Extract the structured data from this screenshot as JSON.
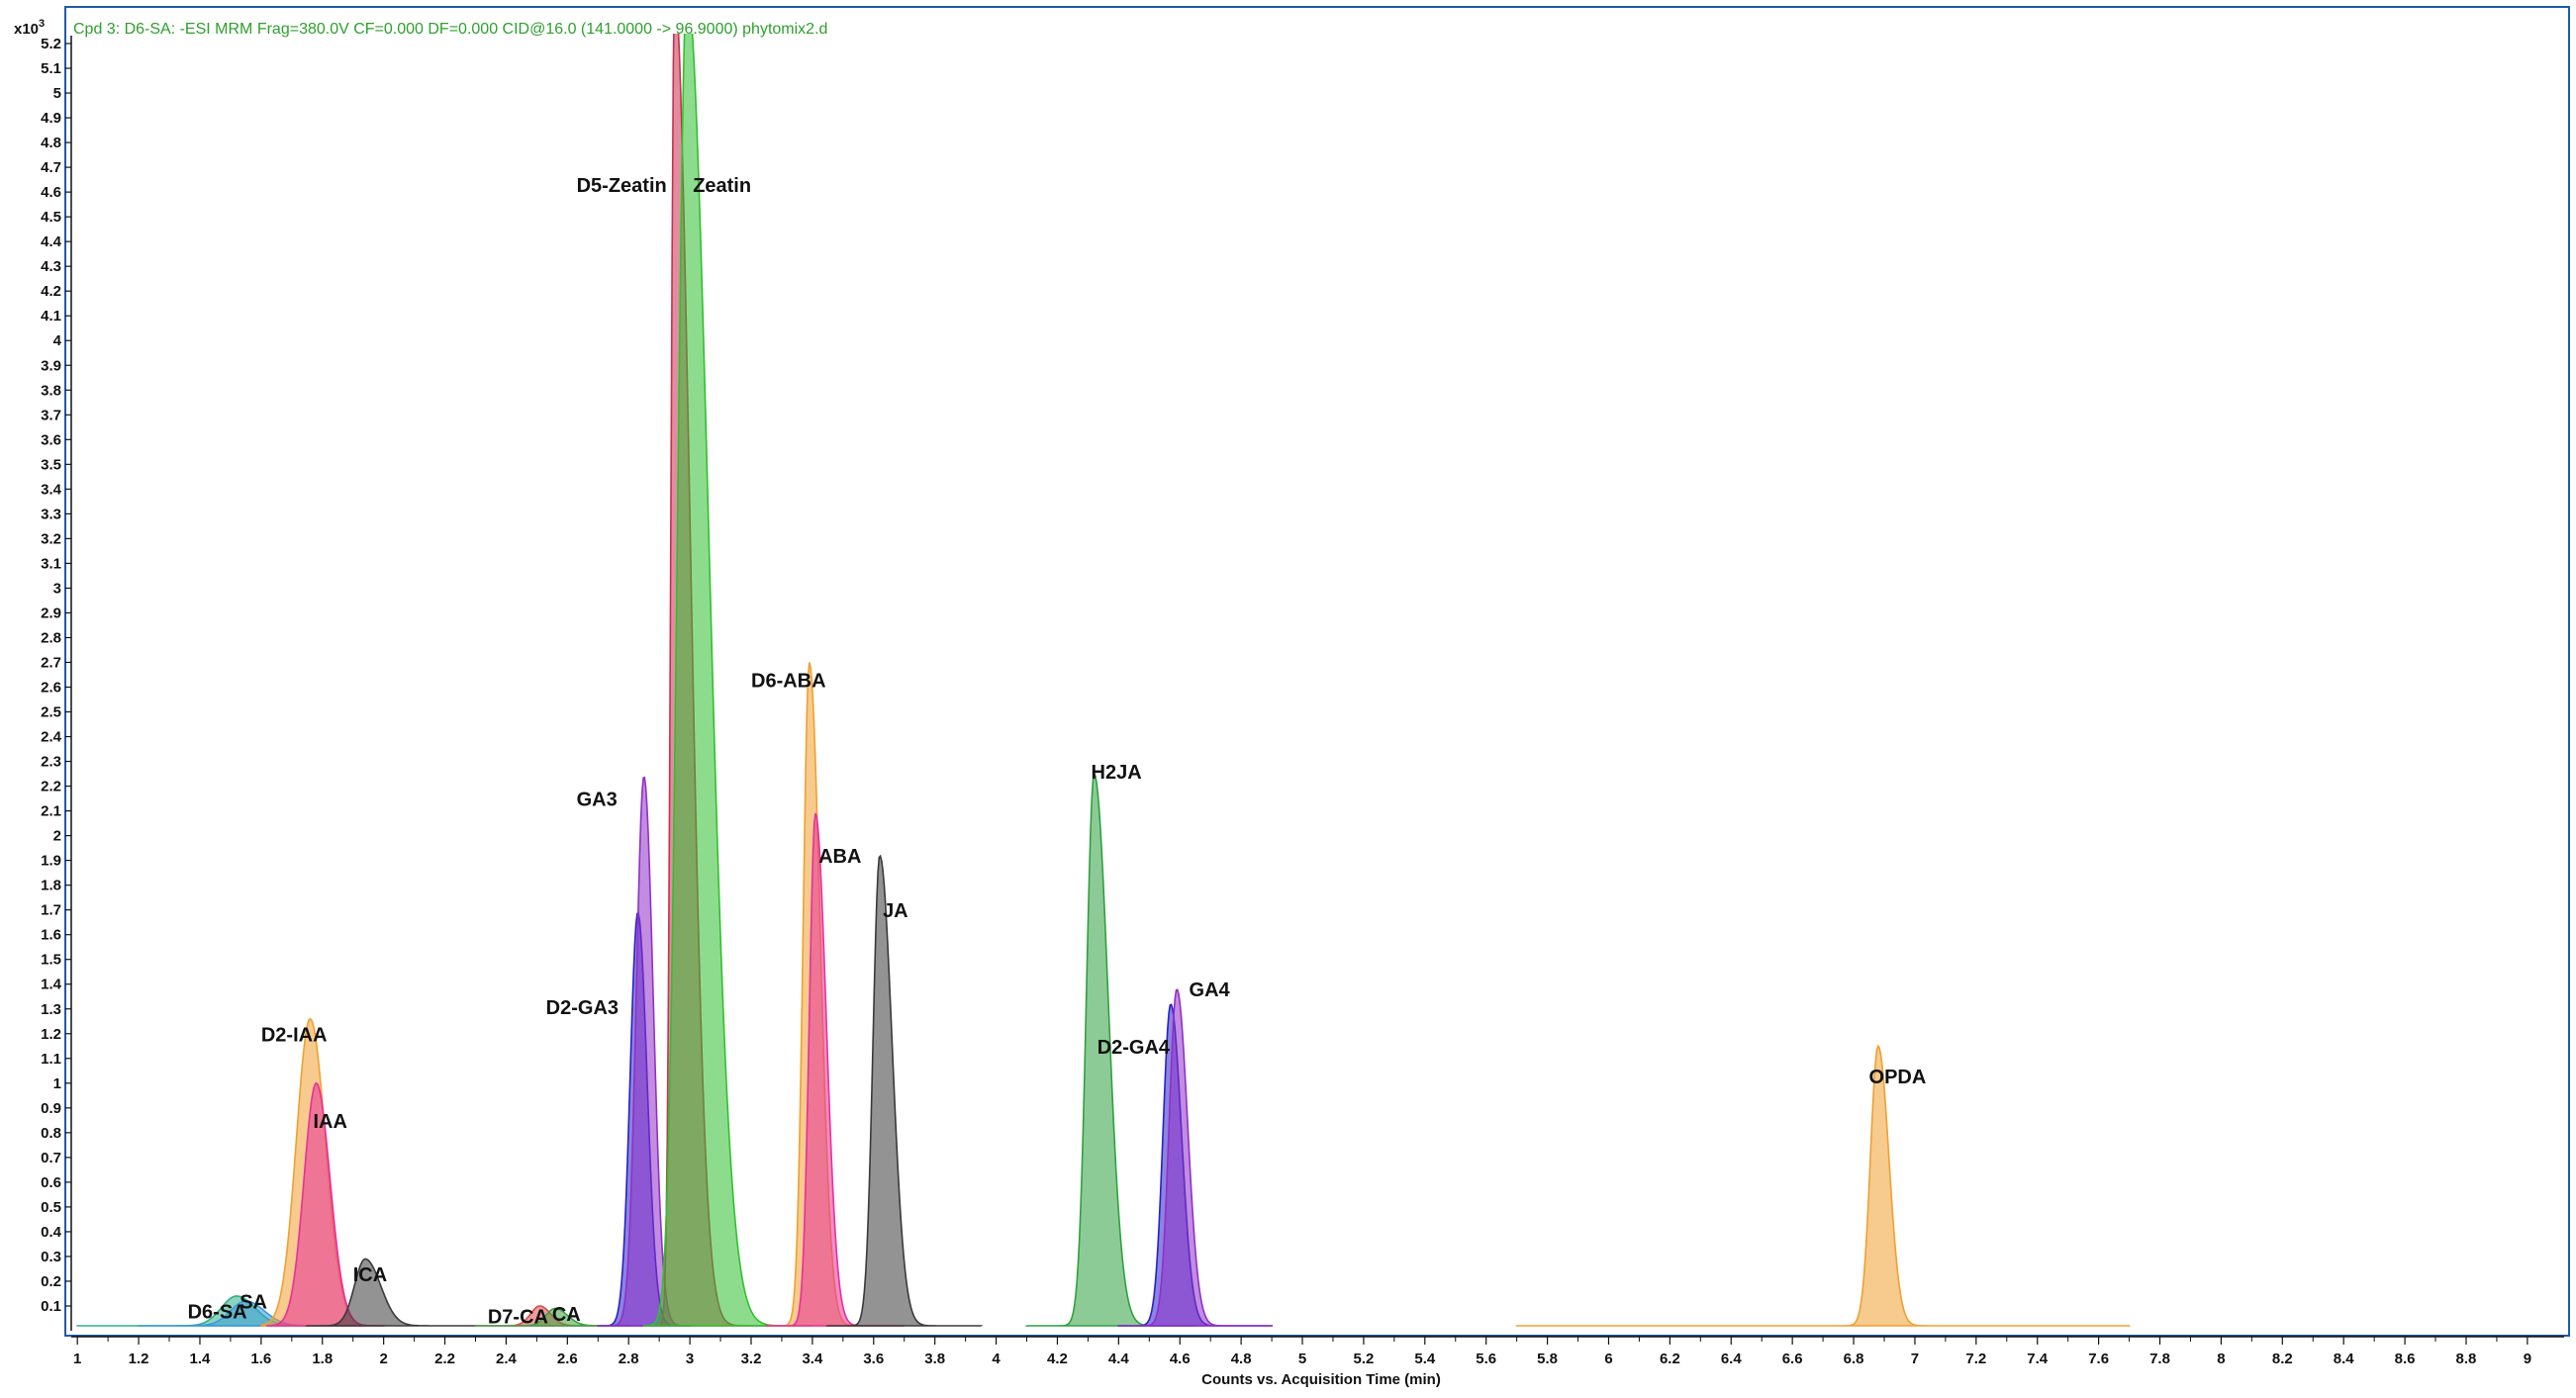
{
  "header": {
    "title": "Cpd 3: D6-SA: -ESI MRM Frag=380.0V CF=0.000 DF=0.000 CID@16.0 (141.0000 -> 96.9000) phytomix2.d",
    "y_multiplier": "x10",
    "y_multiplier_exp": "3"
  },
  "chart_data": {
    "type": "area",
    "xlabel": "Counts vs. Acquisition Time (min)",
    "ylabel": "",
    "xlim": [
      0.98,
      9.12
    ],
    "ylim": [
      0,
      5.2
    ],
    "x_ticks": [
      "1",
      "1.2",
      "1.4",
      "1.6",
      "1.8",
      "2",
      "2.2",
      "2.4",
      "2.6",
      "2.8",
      "3",
      "3.2",
      "3.4",
      "3.6",
      "3.8",
      "4",
      "4.2",
      "4.4",
      "4.6",
      "4.8",
      "5",
      "5.2",
      "5.4",
      "5.6",
      "5.8",
      "6",
      "6.2",
      "6.4",
      "6.6",
      "6.8",
      "7",
      "7.2",
      "7.4",
      "7.6",
      "7.8",
      "8",
      "8.2",
      "8.4",
      "8.6",
      "8.8",
      "9"
    ],
    "y_ticks": [
      "0.1",
      "0.2",
      "0.3",
      "0.4",
      "0.5",
      "0.6",
      "0.7",
      "0.8",
      "0.9",
      "1",
      "1.1",
      "1.2",
      "1.3",
      "1.4",
      "1.5",
      "1.6",
      "1.7",
      "1.8",
      "1.9",
      "2",
      "2.1",
      "2.2",
      "2.3",
      "2.4",
      "2.5",
      "2.6",
      "2.7",
      "2.8",
      "2.9",
      "3",
      "3.1",
      "3.2",
      "3.3",
      "3.4",
      "3.5",
      "3.6",
      "3.7",
      "3.8",
      "3.9",
      "4",
      "4.1",
      "4.2",
      "4.3",
      "4.4",
      "4.5",
      "4.6",
      "4.7",
      "4.8",
      "4.9",
      "5",
      "5.1",
      "5.2"
    ],
    "series": [
      {
        "name": "D6-SA",
        "rt": 1.52,
        "height": 0.12,
        "w_left": 0.05,
        "w_right": 0.06,
        "range": [
          1.0,
          1.8
        ],
        "color": "#2fb08a"
      },
      {
        "name": "SA",
        "rt": 1.55,
        "height": 0.1,
        "w_left": 0.05,
        "w_right": 0.06,
        "range": [
          1.2,
          1.9
        ],
        "color": "#3a9ad9"
      },
      {
        "name": "D2-IAA",
        "rt": 1.76,
        "height": 1.24,
        "w_left": 0.045,
        "w_right": 0.05,
        "range": [
          1.6,
          2.0
        ],
        "color": "#f0a030"
      },
      {
        "name": "IAA",
        "rt": 1.78,
        "height": 0.98,
        "w_left": 0.04,
        "w_right": 0.045,
        "range": [
          1.62,
          2.0
        ],
        "color": "#e8309a"
      },
      {
        "name": "ICA",
        "rt": 1.94,
        "height": 0.27,
        "w_left": 0.035,
        "w_right": 0.05,
        "range": [
          1.75,
          2.3
        ],
        "color": "#3a3a3a"
      },
      {
        "name": "D7-CA",
        "rt": 2.51,
        "height": 0.08,
        "w_left": 0.03,
        "w_right": 0.035,
        "range": [
          2.3,
          2.7
        ],
        "color": "#e04848"
      },
      {
        "name": "CA",
        "rt": 2.56,
        "height": 0.07,
        "w_left": 0.03,
        "w_right": 0.04,
        "range": [
          2.3,
          2.8
        ],
        "color": "#3fa044"
      },
      {
        "name": "D2-GA3",
        "rt": 2.83,
        "height": 1.67,
        "w_left": 0.025,
        "w_right": 0.03,
        "range": [
          2.7,
          3.0
        ],
        "color": "#2a20c8"
      },
      {
        "name": "GA3",
        "rt": 2.85,
        "height": 2.22,
        "w_left": 0.025,
        "w_right": 0.03,
        "range": [
          2.7,
          3.0
        ],
        "color": "#9030c8"
      },
      {
        "name": "D5-Zeatin",
        "rt": 2.95,
        "height": 5.4,
        "w_left": 0.012,
        "w_right": 0.05,
        "range": [
          2.85,
          3.3
        ],
        "color": "#c83050"
      },
      {
        "name": "Zeatin",
        "rt": 2.99,
        "height": 5.4,
        "w_left": 0.03,
        "w_right": 0.07,
        "range": [
          2.85,
          3.4
        ],
        "color": "#30c030"
      },
      {
        "name": "D6-ABA",
        "rt": 3.39,
        "height": 2.68,
        "w_left": 0.02,
        "w_right": 0.035,
        "range": [
          3.25,
          3.7
        ],
        "color": "#f0a030"
      },
      {
        "name": "ABA",
        "rt": 3.41,
        "height": 2.07,
        "w_left": 0.02,
        "w_right": 0.035,
        "range": [
          3.25,
          3.7
        ],
        "color": "#e8309a"
      },
      {
        "name": "JA",
        "rt": 3.62,
        "height": 1.9,
        "w_left": 0.022,
        "w_right": 0.04,
        "range": [
          3.45,
          3.95
        ],
        "color": "#3a3a3a"
      },
      {
        "name": "H2JA",
        "rt": 4.32,
        "height": 2.23,
        "w_left": 0.025,
        "w_right": 0.045,
        "range": [
          4.1,
          4.65
        ],
        "color": "#2fa040"
      },
      {
        "name": "D2-GA4",
        "rt": 4.57,
        "height": 1.3,
        "w_left": 0.025,
        "w_right": 0.035,
        "range": [
          4.4,
          4.9
        ],
        "color": "#2a20c8"
      },
      {
        "name": "GA4",
        "rt": 4.59,
        "height": 1.36,
        "w_left": 0.025,
        "w_right": 0.035,
        "range": [
          4.4,
          4.9
        ],
        "color": "#9030c8"
      },
      {
        "name": "OPDA",
        "rt": 6.88,
        "height": 1.13,
        "w_left": 0.025,
        "w_right": 0.035,
        "range": [
          5.7,
          7.7
        ],
        "color": "#f0a030"
      }
    ],
    "annotations": [
      {
        "text": "D6-SA",
        "x": 1.36,
        "y": 0.05
      },
      {
        "text": "SA",
        "x": 1.53,
        "y": 0.09
      },
      {
        "text": "D2-IAA",
        "x": 1.6,
        "y": 1.17
      },
      {
        "text": "IAA",
        "x": 1.77,
        "y": 0.82
      },
      {
        "text": "ICA",
        "x": 1.9,
        "y": 0.2
      },
      {
        "text": "D7-CA",
        "x": 2.34,
        "y": 0.03
      },
      {
        "text": "CA",
        "x": 2.55,
        "y": 0.04
      },
      {
        "text": "GA3",
        "x": 2.63,
        "y": 2.12
      },
      {
        "text": "D2-GA3",
        "x": 2.53,
        "y": 1.28
      },
      {
        "text": "D5-Zeatin",
        "x": 2.63,
        "y": 4.6
      },
      {
        "text": "Zeatin",
        "x": 3.01,
        "y": 4.6
      },
      {
        "text": "D6-ABA",
        "x": 3.2,
        "y": 2.6
      },
      {
        "text": "ABA",
        "x": 3.42,
        "y": 1.89
      },
      {
        "text": "JA",
        "x": 3.63,
        "y": 1.67
      },
      {
        "text": "H2JA",
        "x": 4.31,
        "y": 2.23
      },
      {
        "text": "D2-GA4",
        "x": 4.33,
        "y": 1.12
      },
      {
        "text": "GA4",
        "x": 4.63,
        "y": 1.35
      },
      {
        "text": "OPDA",
        "x": 6.85,
        "y": 1.0
      }
    ],
    "grid": false,
    "legend": "none"
  }
}
